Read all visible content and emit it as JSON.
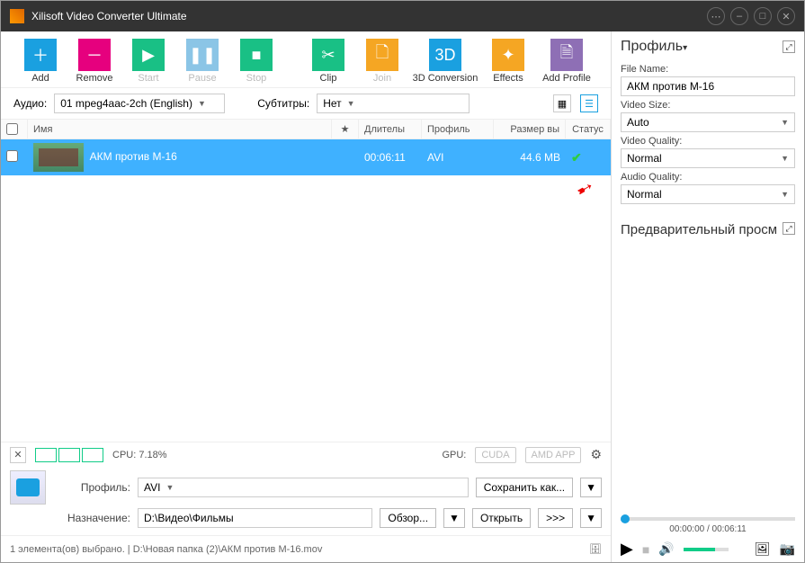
{
  "window": {
    "title": "Xilisoft Video Converter Ultimate"
  },
  "toolbar": {
    "add": "Add",
    "remove": "Remove",
    "start": "Start",
    "pause": "Pause",
    "stop": "Stop",
    "clip": "Clip",
    "join": "Join",
    "conv3d": "3D Conversion",
    "effects": "Effects",
    "addprofile": "Add Profile"
  },
  "filters": {
    "audio_label": "Аудио:",
    "audio_value": "01 mpeg4aac-2ch (English)",
    "subs_label": "Субтитры:",
    "subs_value": "Нет"
  },
  "columns": {
    "name": "Имя",
    "star": "★",
    "duration": "Длителы",
    "profile": "Профиль",
    "size": "Размер вы",
    "status": "Статус"
  },
  "items": [
    {
      "name": "АКМ против М-16",
      "duration": "00:06:11",
      "profile": "AVI",
      "size": "44.6 MB",
      "status": "done"
    }
  ],
  "perf": {
    "cpu_label": "CPU: 7.18%",
    "gpu_label": "GPU:",
    "cuda": "CUDA",
    "amd": "AMD APP"
  },
  "form": {
    "profile_label": "Профиль:",
    "profile_value": "AVI",
    "saveas": "Сохранить как...",
    "dest_label": "Назначение:",
    "dest_value": "D:\\Видео\\Фильмы",
    "browse": "Обзор...",
    "open": "Открыть",
    "chev": ">>>"
  },
  "status": {
    "text": "1 элемента(ов) выбрано. | D:\\Новая папка (2)\\АКМ против М-16.mov"
  },
  "right": {
    "profile_hdr": "Профиль",
    "filename_label": "File Name:",
    "filename_value": "АКМ против М-16",
    "videosize_label": "Video Size:",
    "videosize_value": "Auto",
    "videoq_label": "Video Quality:",
    "videoq_value": "Normal",
    "audioq_label": "Audio Quality:",
    "audioq_value": "Normal",
    "preview_hdr": "Предварительный просм",
    "time": "00:00:00 / 00:06:11"
  }
}
